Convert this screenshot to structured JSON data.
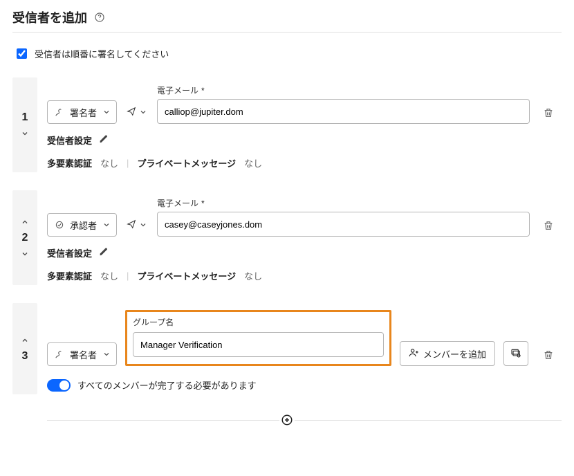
{
  "header": {
    "title": "受信者を追加"
  },
  "sequential": {
    "checked": true,
    "label": "受信者は順番に署名してください"
  },
  "labels": {
    "email": "電子メール",
    "group_name": "グループ名",
    "recipient_settings": "受信者設定",
    "mfa": "多要素認証",
    "private_msg": "プライベートメッセージ",
    "none": "なし",
    "add_member": "メンバーを追加",
    "toggle_all_complete": "すべてのメンバーが完了する必要があります"
  },
  "role": {
    "signer": "署名者",
    "approver": "承認者"
  },
  "recipients": [
    {
      "order": "1",
      "role": "signer",
      "email": "calliop@jupiter.dom",
      "mfa": "none",
      "private_msg": "none",
      "show_up": false,
      "show_down": true
    },
    {
      "order": "2",
      "role": "approver",
      "email": "casey@caseyjones.dom",
      "mfa": "none",
      "private_msg": "none",
      "show_up": true,
      "show_down": true
    }
  ],
  "group_recipient": {
    "order": "3",
    "role": "signer",
    "group_name": "Manager Verification",
    "all_must_complete": true,
    "show_up": true,
    "show_down": false
  }
}
